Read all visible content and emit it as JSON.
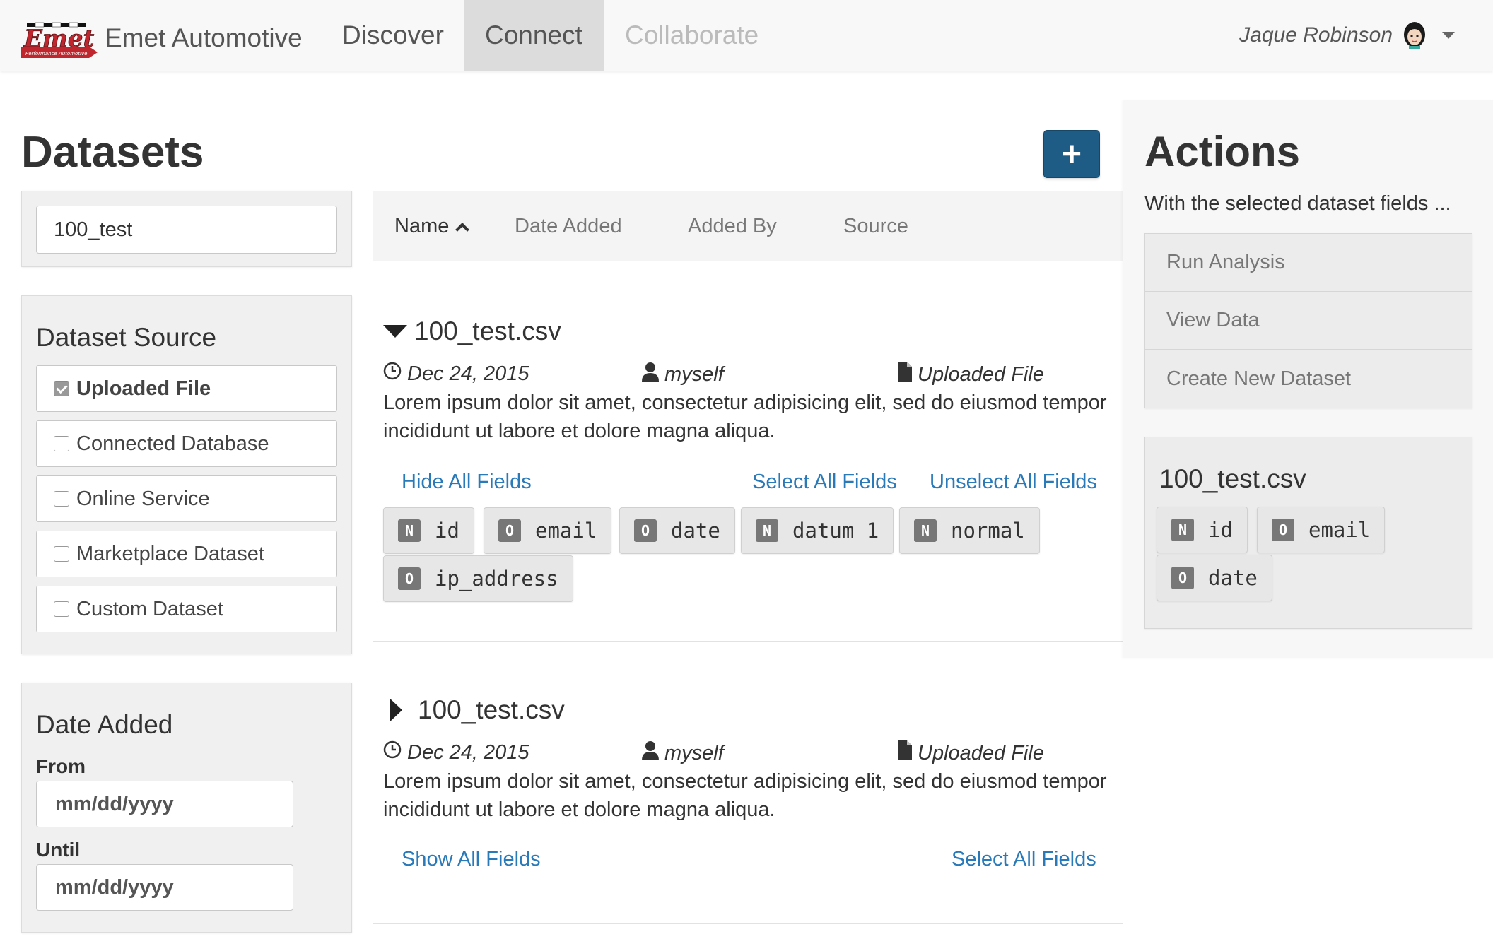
{
  "navbar": {
    "brand_logo_text": "Emet",
    "brand_logo_tagline": "Performance Automotive",
    "brand_name": "Emet Automotive",
    "items": [
      {
        "label": "Discover",
        "state": "normal"
      },
      {
        "label": "Connect",
        "state": "active"
      },
      {
        "label": "Collaborate",
        "state": "disabled"
      }
    ],
    "user_name": "Jaque Robinson",
    "avatar_icon": "user-avatar-icon",
    "menu_icon": "caret-down-icon"
  },
  "page": {
    "title": "Datasets",
    "add_button_label": "+"
  },
  "filters": {
    "search_value": "100_test",
    "source_title": "Dataset Source",
    "sources": [
      {
        "label": "Uploaded File",
        "checked": true
      },
      {
        "label": "Connected Database",
        "checked": false
      },
      {
        "label": "Online Service",
        "checked": false
      },
      {
        "label": "Marketplace Dataset",
        "checked": false
      },
      {
        "label": "Custom Dataset",
        "checked": false
      }
    ],
    "date_title": "Date Added",
    "from_label": "From",
    "from_placeholder": "mm/dd/yyyy",
    "until_label": "Until",
    "until_placeholder": "mm/dd/yyyy"
  },
  "sortbar": {
    "columns": [
      {
        "label": "Name",
        "active": true,
        "direction": "ascending"
      },
      {
        "label": "Date Added",
        "active": false
      },
      {
        "label": "Added By",
        "active": false
      },
      {
        "label": "Source",
        "active": false
      }
    ]
  },
  "datasets": [
    {
      "name": "100_test.csv",
      "expanded": true,
      "date": "Dec 24, 2015",
      "added_by": "myself",
      "source": "Uploaded File",
      "description": "Lorem ipsum dolor sit amet, consectetur adipisicing elit, sed do eiusmod tempor incididunt ut labore et dolore magna aliqua.",
      "toggle_label": "Hide All Fields",
      "select_label": "Select All Fields",
      "unselect_label": "Unselect All Fields",
      "fields": [
        {
          "type": "N",
          "name": "id"
        },
        {
          "type": "O",
          "name": "email"
        },
        {
          "type": "O",
          "name": "date"
        },
        {
          "type": "N",
          "name": "datum 1"
        },
        {
          "type": "N",
          "name": "normal"
        },
        {
          "type": "O",
          "name": "ip_address"
        }
      ]
    },
    {
      "name": "100_test.csv",
      "expanded": false,
      "date": "Dec 24, 2015",
      "added_by": "myself",
      "source": "Uploaded File",
      "description": "Lorem ipsum dolor sit amet, consectetur adipisicing elit, sed do eiusmod tempor incididunt ut labore et dolore magna aliqua.",
      "toggle_label": "Show All Fields",
      "select_label": "Select All Fields"
    }
  ],
  "actions": {
    "title": "Actions",
    "subtitle": "With the selected dataset fields ...",
    "items": [
      "Run Analysis",
      "View Data",
      "Create New Dataset"
    ],
    "selected": {
      "name": "100_test.csv",
      "fields": [
        {
          "type": "N",
          "name": "id"
        },
        {
          "type": "O",
          "name": "email"
        },
        {
          "type": "O",
          "name": "date"
        }
      ]
    }
  },
  "colors": {
    "link": "#2a7ab9",
    "primary_button": "#1e5b85",
    "logo_red": "#c0262d"
  }
}
